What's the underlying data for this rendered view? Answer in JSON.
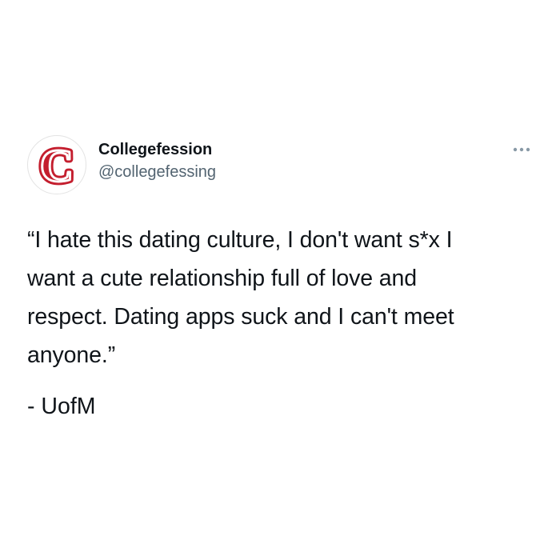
{
  "author": {
    "avatar_letter": "C",
    "avatar_color": "#c41e2e",
    "display_name": "Collegefession",
    "handle": "@collegefessing"
  },
  "menu": {
    "icon": "more-horizontal-icon",
    "color": "#8899a6"
  },
  "tweet": {
    "text": "“I hate this dating culture, I don't want s*x I\nwant a cute relationship full of love and\nrespect. Dating apps suck and I can't meet\nanyone.”",
    "attribution": "- UofM"
  }
}
